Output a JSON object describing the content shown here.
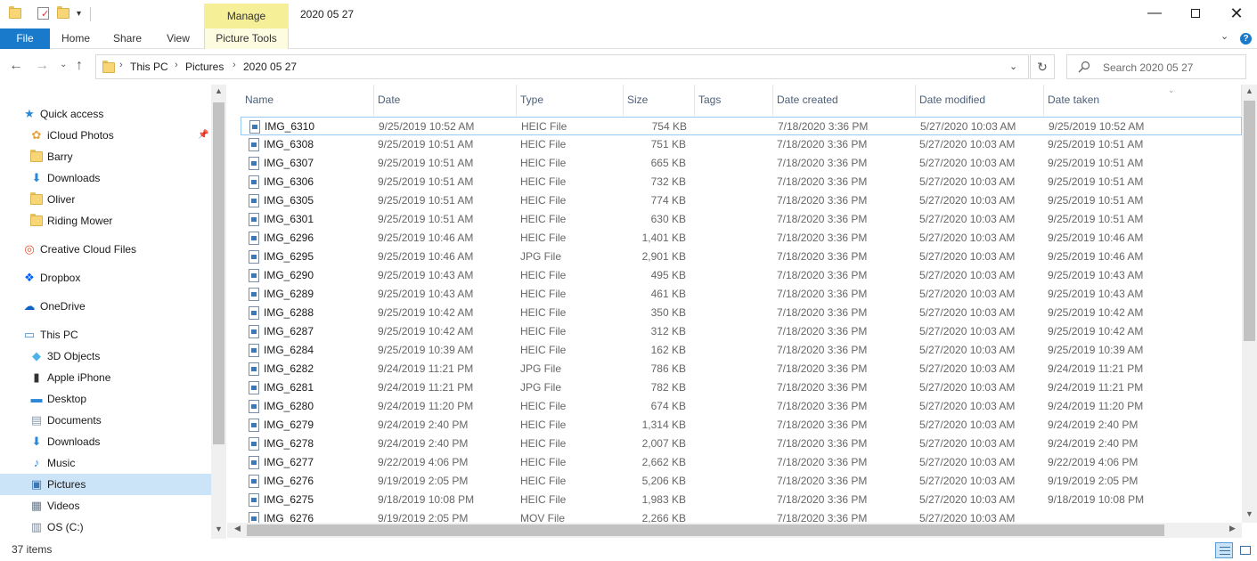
{
  "window": {
    "title": "2020 05 27",
    "manage_label": "Manage",
    "minimize": "—",
    "close": "✕"
  },
  "ribbon": {
    "tabs": [
      "File",
      "Home",
      "Share",
      "View",
      "Picture Tools"
    ],
    "expand_glyph": "⌄",
    "help_glyph": "?"
  },
  "nav": {
    "back_glyph": "←",
    "forward_glyph": "→",
    "recent_glyph": "⌄",
    "up_glyph": "↑",
    "refresh_glyph": "↻",
    "dropdown_glyph": "⌄"
  },
  "address": {
    "crumbs": [
      "This PC",
      "Pictures",
      "2020 05 27"
    ],
    "separator": "›"
  },
  "search": {
    "placeholder": "Search 2020 05 27"
  },
  "navpane": {
    "items": [
      {
        "label": "Quick access",
        "icon": "star-icon"
      },
      {
        "label": "iCloud Photos",
        "icon": "icloud-photos-icon",
        "pinned": true
      },
      {
        "label": "Barry",
        "icon": "folder-icon"
      },
      {
        "label": "Downloads",
        "icon": "download-icon"
      },
      {
        "label": "Oliver",
        "icon": "folder-icon"
      },
      {
        "label": "Riding Mower",
        "icon": "folder-icon"
      },
      {
        "label": "Creative Cloud Files",
        "icon": "creative-cloud-icon"
      },
      {
        "label": "Dropbox",
        "icon": "dropbox-icon"
      },
      {
        "label": "OneDrive",
        "icon": "onedrive-icon"
      },
      {
        "label": "This PC",
        "icon": "computer-icon"
      },
      {
        "label": "3D Objects",
        "icon": "cube-icon"
      },
      {
        "label": "Apple iPhone",
        "icon": "phone-icon"
      },
      {
        "label": "Desktop",
        "icon": "desktop-icon"
      },
      {
        "label": "Documents",
        "icon": "document-icon"
      },
      {
        "label": "Downloads",
        "icon": "download-icon"
      },
      {
        "label": "Music",
        "icon": "music-icon"
      },
      {
        "label": "Pictures",
        "icon": "pictures-icon",
        "selected": true
      },
      {
        "label": "Videos",
        "icon": "video-icon"
      },
      {
        "label": "OS (C:)",
        "icon": "drive-icon"
      }
    ],
    "pin_glyph": "📌"
  },
  "columns": [
    "Name",
    "Date",
    "Type",
    "Size",
    "Tags",
    "Date created",
    "Date modified",
    "Date taken"
  ],
  "files": [
    [
      "IMG_6310",
      "9/25/2019 10:52 AM",
      "HEIC File",
      "754 KB",
      "",
      "7/18/2020 3:36 PM",
      "5/27/2020 10:03 AM",
      "9/25/2019 10:52 AM"
    ],
    [
      "IMG_6308",
      "9/25/2019 10:51 AM",
      "HEIC File",
      "751 KB",
      "",
      "7/18/2020 3:36 PM",
      "5/27/2020 10:03 AM",
      "9/25/2019 10:51 AM"
    ],
    [
      "IMG_6307",
      "9/25/2019 10:51 AM",
      "HEIC File",
      "665 KB",
      "",
      "7/18/2020 3:36 PM",
      "5/27/2020 10:03 AM",
      "9/25/2019 10:51 AM"
    ],
    [
      "IMG_6306",
      "9/25/2019 10:51 AM",
      "HEIC File",
      "732 KB",
      "",
      "7/18/2020 3:36 PM",
      "5/27/2020 10:03 AM",
      "9/25/2019 10:51 AM"
    ],
    [
      "IMG_6305",
      "9/25/2019 10:51 AM",
      "HEIC File",
      "774 KB",
      "",
      "7/18/2020 3:36 PM",
      "5/27/2020 10:03 AM",
      "9/25/2019 10:51 AM"
    ],
    [
      "IMG_6301",
      "9/25/2019 10:51 AM",
      "HEIC File",
      "630 KB",
      "",
      "7/18/2020 3:36 PM",
      "5/27/2020 10:03 AM",
      "9/25/2019 10:51 AM"
    ],
    [
      "IMG_6296",
      "9/25/2019 10:46 AM",
      "HEIC File",
      "1,401 KB",
      "",
      "7/18/2020 3:36 PM",
      "5/27/2020 10:03 AM",
      "9/25/2019 10:46 AM"
    ],
    [
      "IMG_6295",
      "9/25/2019 10:46 AM",
      "JPG File",
      "2,901 KB",
      "",
      "7/18/2020 3:36 PM",
      "5/27/2020 10:03 AM",
      "9/25/2019 10:46 AM"
    ],
    [
      "IMG_6290",
      "9/25/2019 10:43 AM",
      "HEIC File",
      "495 KB",
      "",
      "7/18/2020 3:36 PM",
      "5/27/2020 10:03 AM",
      "9/25/2019 10:43 AM"
    ],
    [
      "IMG_6289",
      "9/25/2019 10:43 AM",
      "HEIC File",
      "461 KB",
      "",
      "7/18/2020 3:36 PM",
      "5/27/2020 10:03 AM",
      "9/25/2019 10:43 AM"
    ],
    [
      "IMG_6288",
      "9/25/2019 10:42 AM",
      "HEIC File",
      "350 KB",
      "",
      "7/18/2020 3:36 PM",
      "5/27/2020 10:03 AM",
      "9/25/2019 10:42 AM"
    ],
    [
      "IMG_6287",
      "9/25/2019 10:42 AM",
      "HEIC File",
      "312 KB",
      "",
      "7/18/2020 3:36 PM",
      "5/27/2020 10:03 AM",
      "9/25/2019 10:42 AM"
    ],
    [
      "IMG_6284",
      "9/25/2019 10:39 AM",
      "HEIC File",
      "162 KB",
      "",
      "7/18/2020 3:36 PM",
      "5/27/2020 10:03 AM",
      "9/25/2019 10:39 AM"
    ],
    [
      "IMG_6282",
      "9/24/2019 11:21 PM",
      "JPG File",
      "786 KB",
      "",
      "7/18/2020 3:36 PM",
      "5/27/2020 10:03 AM",
      "9/24/2019 11:21 PM"
    ],
    [
      "IMG_6281",
      "9/24/2019 11:21 PM",
      "JPG File",
      "782 KB",
      "",
      "7/18/2020 3:36 PM",
      "5/27/2020 10:03 AM",
      "9/24/2019 11:21 PM"
    ],
    [
      "IMG_6280",
      "9/24/2019 11:20 PM",
      "HEIC File",
      "674 KB",
      "",
      "7/18/2020 3:36 PM",
      "5/27/2020 10:03 AM",
      "9/24/2019 11:20 PM"
    ],
    [
      "IMG_6279",
      "9/24/2019 2:40 PM",
      "HEIC File",
      "1,314 KB",
      "",
      "7/18/2020 3:36 PM",
      "5/27/2020 10:03 AM",
      "9/24/2019 2:40 PM"
    ],
    [
      "IMG_6278",
      "9/24/2019 2:40 PM",
      "HEIC File",
      "2,007 KB",
      "",
      "7/18/2020 3:36 PM",
      "5/27/2020 10:03 AM",
      "9/24/2019 2:40 PM"
    ],
    [
      "IMG_6277",
      "9/22/2019 4:06 PM",
      "HEIC File",
      "2,662 KB",
      "",
      "7/18/2020 3:36 PM",
      "5/27/2020 10:03 AM",
      "9/22/2019 4:06 PM"
    ],
    [
      "IMG_6276",
      "9/19/2019 2:05 PM",
      "HEIC File",
      "5,206 KB",
      "",
      "7/18/2020 3:36 PM",
      "5/27/2020 10:03 AM",
      "9/19/2019 2:05 PM"
    ],
    [
      "IMG_6275",
      "9/18/2019 10:08 PM",
      "HEIC File",
      "1,983 KB",
      "",
      "7/18/2020 3:36 PM",
      "5/27/2020 10:03 AM",
      "9/18/2019 10:08 PM"
    ],
    [
      "IMG_6276",
      "9/19/2019 2:05 PM",
      "MOV File",
      "2,266 KB",
      "",
      "7/18/2020 3:36 PM",
      "5/27/2020 10:03 AM",
      ""
    ]
  ],
  "status": {
    "item_count": "37 items"
  },
  "colors": {
    "file_tab": "#1979ca",
    "manage_tab": "#f5ef98",
    "selection": "#cce4f7",
    "header_text": "#4c607a"
  }
}
